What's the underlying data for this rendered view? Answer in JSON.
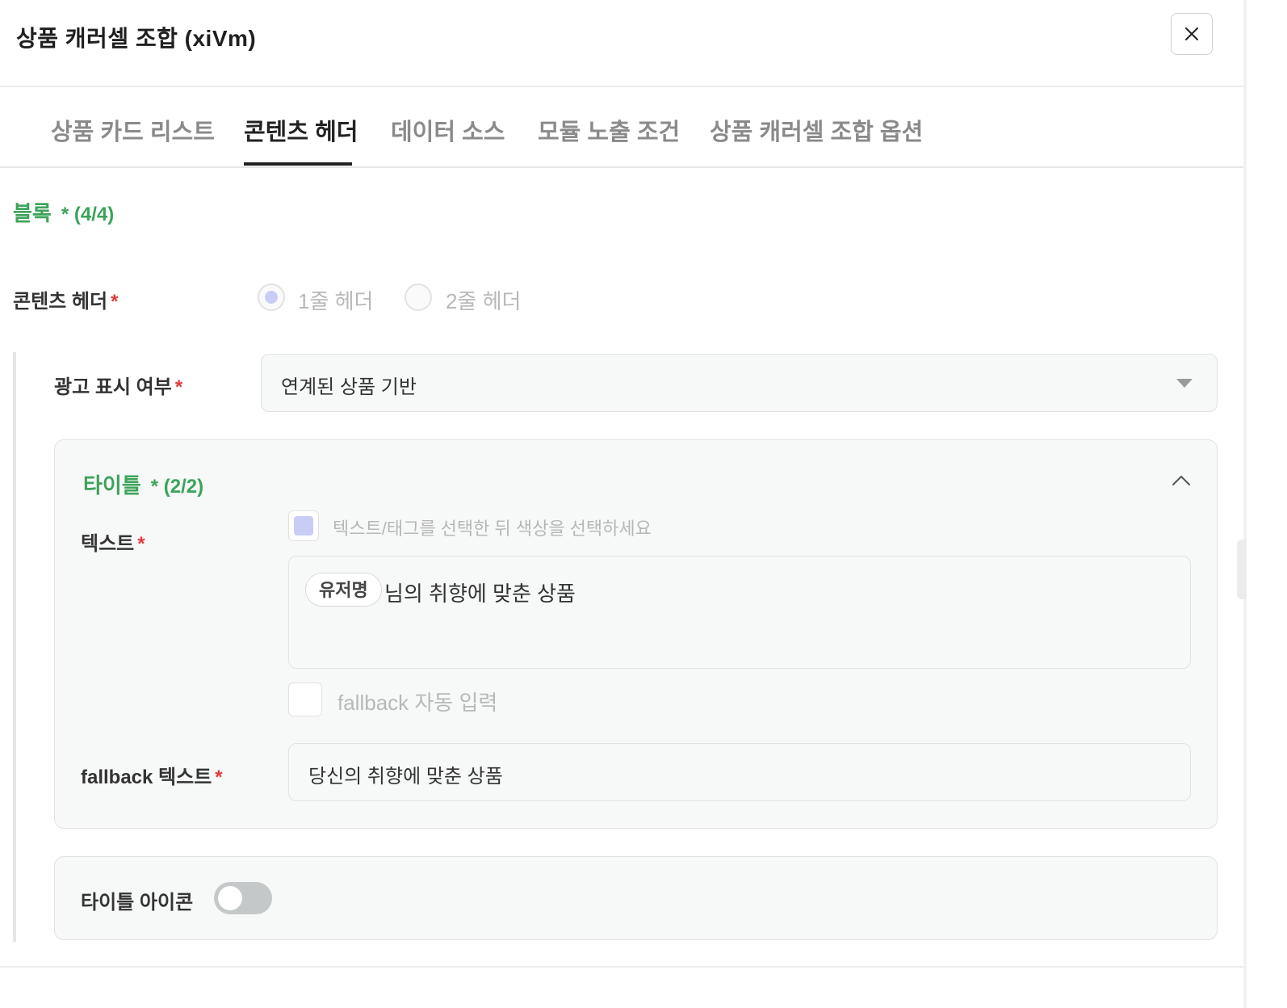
{
  "window": {
    "title": "상품 캐러셀 조합 (xiVm)"
  },
  "tabs": [
    {
      "label": "상품 카드 리스트",
      "active": false
    },
    {
      "label": "콘텐츠 헤더",
      "active": true
    },
    {
      "label": "데이터 소스",
      "active": false
    },
    {
      "label": "모듈 노출 조건",
      "active": false
    },
    {
      "label": "상품 캐러셀 조합 옵션",
      "active": false
    }
  ],
  "block": {
    "label": "블록",
    "count": "* (4/4)"
  },
  "content_header": {
    "label": "콘텐츠 헤더",
    "required": "*",
    "options": [
      "1줄 헤더",
      "2줄 헤더"
    ],
    "selected": "1줄 헤더"
  },
  "ad_display": {
    "label": "광고 표시 여부",
    "required": "*",
    "value": "연계된 상품 기반"
  },
  "title_card": {
    "label": "타이틀",
    "count": "* (2/2)",
    "text_label": "텍스트",
    "text_required": "*",
    "color_hint": "텍스트/태그를 선택한 뒤 색상을 선택하세요",
    "tag_chip": "유저명",
    "text_value": "님의 취향에 맞춘 상품",
    "fallback_checkbox_label": "fallback 자동 입력",
    "fallback_label": "fallback 텍스트",
    "fallback_required": "*",
    "fallback_value": "당신의 취향에 맞춘 상품"
  },
  "title_icon": {
    "label": "타이틀 아이콘",
    "enabled": false
  },
  "colors": {
    "accent_green": "#3ca35a",
    "required_red": "#e23b3b",
    "radio_fill": "#c9cdf6"
  }
}
